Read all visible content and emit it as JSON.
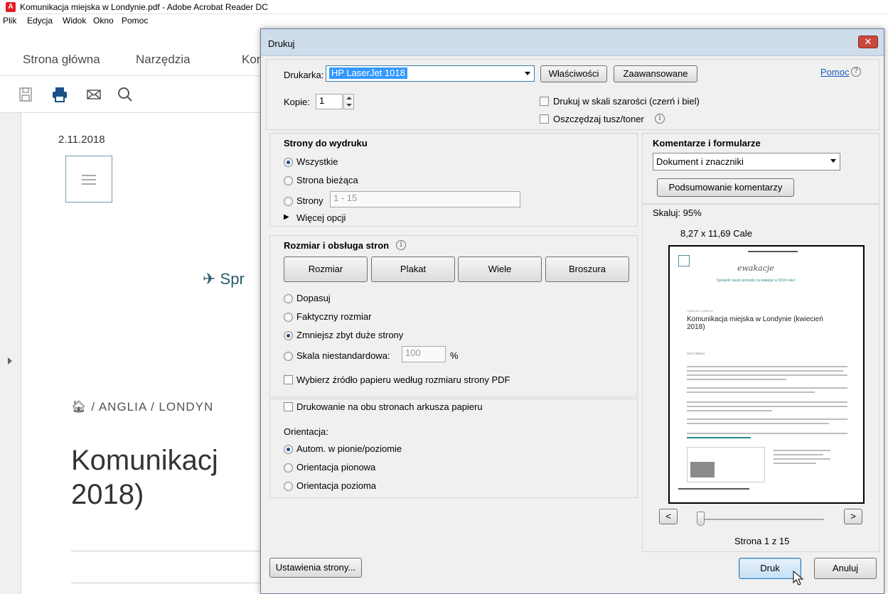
{
  "app": {
    "window_title": "Komunikacja miejska w Londynie.pdf - Adobe Acrobat Reader DC",
    "menu": [
      "Plik",
      "Edycja",
      "Widok",
      "Okno",
      "Pomoc"
    ],
    "tabs": [
      "Strona główna",
      "Narzędzia",
      "Kon"
    ],
    "toolbar_icons": [
      "save-icon",
      "print-icon",
      "mail-icon",
      "search-icon"
    ]
  },
  "document": {
    "date": "2.11.2018",
    "promo_text": "✈ Spr",
    "breadcrumb": "/ ANGLIA / LONDYN",
    "heading": "Komunikacj\n2018)"
  },
  "dialog": {
    "title": "Drukuj",
    "close_label": "✕",
    "printer_label": "Drukarka:",
    "printer_value": "HP LaserJet 1018",
    "properties_label": "Właściwości",
    "advanced_label": "Zaawansowane",
    "help_label": "Pomoc",
    "copies_label": "Kopie:",
    "copies_value": "1",
    "grayscale_label": "Drukuj w skali szarości (czerń i biel)",
    "save_ink_label": "Oszczędzaj tusz/toner",
    "pages_section": {
      "title": "Strony do wydruku",
      "all": "Wszystkie",
      "current": "Strona bieżąca",
      "pages": "Strony",
      "pages_value": "1 - 15",
      "more": "Więcej opcji",
      "selected": "all"
    },
    "size_section": {
      "title": "Rozmiar i obsługa stron",
      "buttons": [
        "Rozmiar",
        "Plakat",
        "Wiele",
        "Broszura"
      ],
      "fit": "Dopasuj",
      "actual": "Faktyczny rozmiar",
      "shrink": "Zmniejsz zbyt duże strony",
      "custom": "Skala niestandardowa:",
      "custom_value": "100",
      "percent": "%",
      "paper_source": "Wybierz źródło papieru według rozmiaru strony PDF",
      "selected": "shrink"
    },
    "duplex_section": {
      "duplex_label": "Drukowanie na obu stronach arkusza papieru",
      "orientation_label": "Orientacja:",
      "auto": "Autom. w pionie/poziomie",
      "portrait": "Orientacja pionowa",
      "landscape": "Orientacja pozioma",
      "selected": "auto"
    },
    "comments_section": {
      "title": "Komentarze i formularze",
      "value": "Dokument i znaczniki",
      "summary_label": "Podsumowanie komentarzy"
    },
    "preview": {
      "scale": "Skaluj:  95%",
      "paper_size": "8,27 x 11,69 Cale",
      "page_indicator": "Strona 1 z 15",
      "prev": "<",
      "next": ">",
      "mini_logo": "ewakacje",
      "mini_link": "Sprawdź nasze pomysły na wakacje w 2018 roku!",
      "mini_breadcrumb": "/ ANGLIA / LONDYN",
      "mini_title": "Komunikacja miejska w Londynie (kwiecień 2018)",
      "mini_toc": "SPIS TREŚCI"
    },
    "page_setup_label": "Ustawienia strony...",
    "print_label": "Druk",
    "cancel_label": "Anuluj"
  }
}
